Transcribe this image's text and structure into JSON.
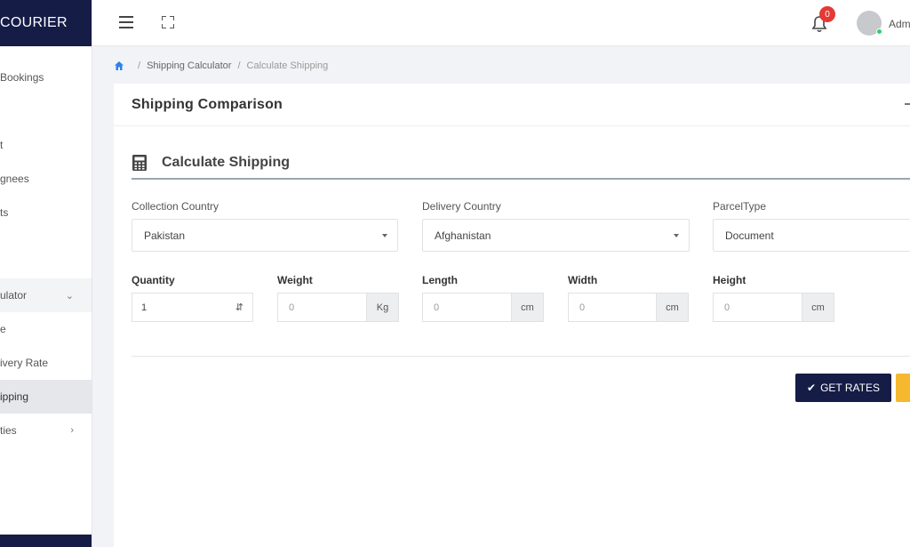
{
  "brand": {
    "name": "COURIER"
  },
  "sidebar": {
    "items": [
      {
        "label": "Bookings"
      },
      {
        "label": "t"
      },
      {
        "label": "gnees"
      },
      {
        "label": "ts"
      },
      {
        "label": "ulator"
      },
      {
        "label": "e"
      },
      {
        "label": "ivery Rate"
      },
      {
        "label": "ipping"
      },
      {
        "label": "ties"
      }
    ]
  },
  "header": {
    "notification_count": "0",
    "user_name": "Adm"
  },
  "breadcrumb": {
    "parent": "Shipping Calculator",
    "current": "Calculate Shipping"
  },
  "card": {
    "title": "Shipping Comparison",
    "section_title": "Calculate Shipping"
  },
  "form": {
    "collection_country": {
      "label": "Collection Country",
      "value": "Pakistan"
    },
    "delivery_country": {
      "label": "Delivery Country",
      "value": "Afghanistan"
    },
    "parcel_type": {
      "label": "ParcelType",
      "value": "Document"
    },
    "quantity": {
      "label": "Quantity",
      "value": "1"
    },
    "weight": {
      "label": "Weight",
      "value": "0",
      "unit": "Kg"
    },
    "length": {
      "label": "Length",
      "value": "0",
      "unit": "cm"
    },
    "width": {
      "label": "Width",
      "value": "0",
      "unit": "cm"
    },
    "height": {
      "label": "Height",
      "value": "0",
      "unit": "cm"
    }
  },
  "actions": {
    "get_rates_label": "GET RATES"
  },
  "colors": {
    "brand_navy": "#151c46",
    "accent_yellow": "#f5b82e",
    "badge_red": "#e53935",
    "online_green": "#2ecc71"
  },
  "icons": {
    "home": "home-icon",
    "calculator": "calculator-icon",
    "bell": "bell-icon",
    "check": "check-icon"
  }
}
